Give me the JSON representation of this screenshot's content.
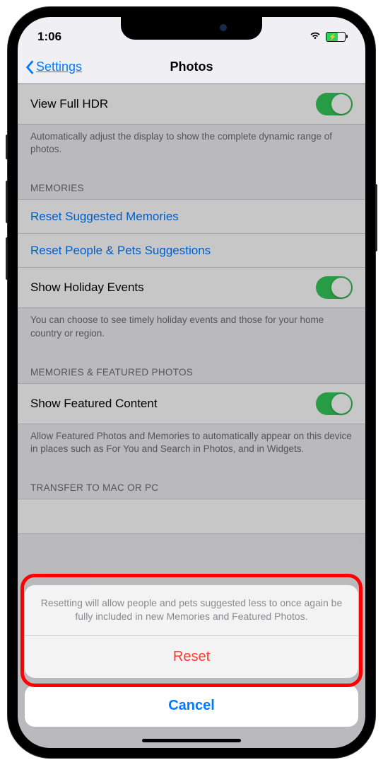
{
  "status": {
    "time": "1:06"
  },
  "nav": {
    "back": "Settings",
    "title": "Photos"
  },
  "hdr": {
    "title": "View Full HDR",
    "footer": "Automatically adjust the display to show the complete dynamic range of photos."
  },
  "memories": {
    "header": "MEMORIES",
    "reset_suggested": "Reset Suggested Memories",
    "reset_people": "Reset People & Pets Suggestions",
    "holiday": "Show Holiday Events",
    "footer": "You can choose to see timely holiday events and those for your home country or region."
  },
  "featured": {
    "header": "MEMORIES & FEATURED PHOTOS",
    "show": "Show Featured Content",
    "footer": "Allow Featured Photos and Memories to automatically appear on this device in places such as For You and Search in Photos, and in Widgets."
  },
  "transfer": {
    "header": "TRANSFER TO MAC OR PC"
  },
  "sheet": {
    "description": "Resetting will allow people and pets suggested less to once again be fully included in new Memories and Featured Photos.",
    "reset": "Reset",
    "cancel": "Cancel"
  }
}
